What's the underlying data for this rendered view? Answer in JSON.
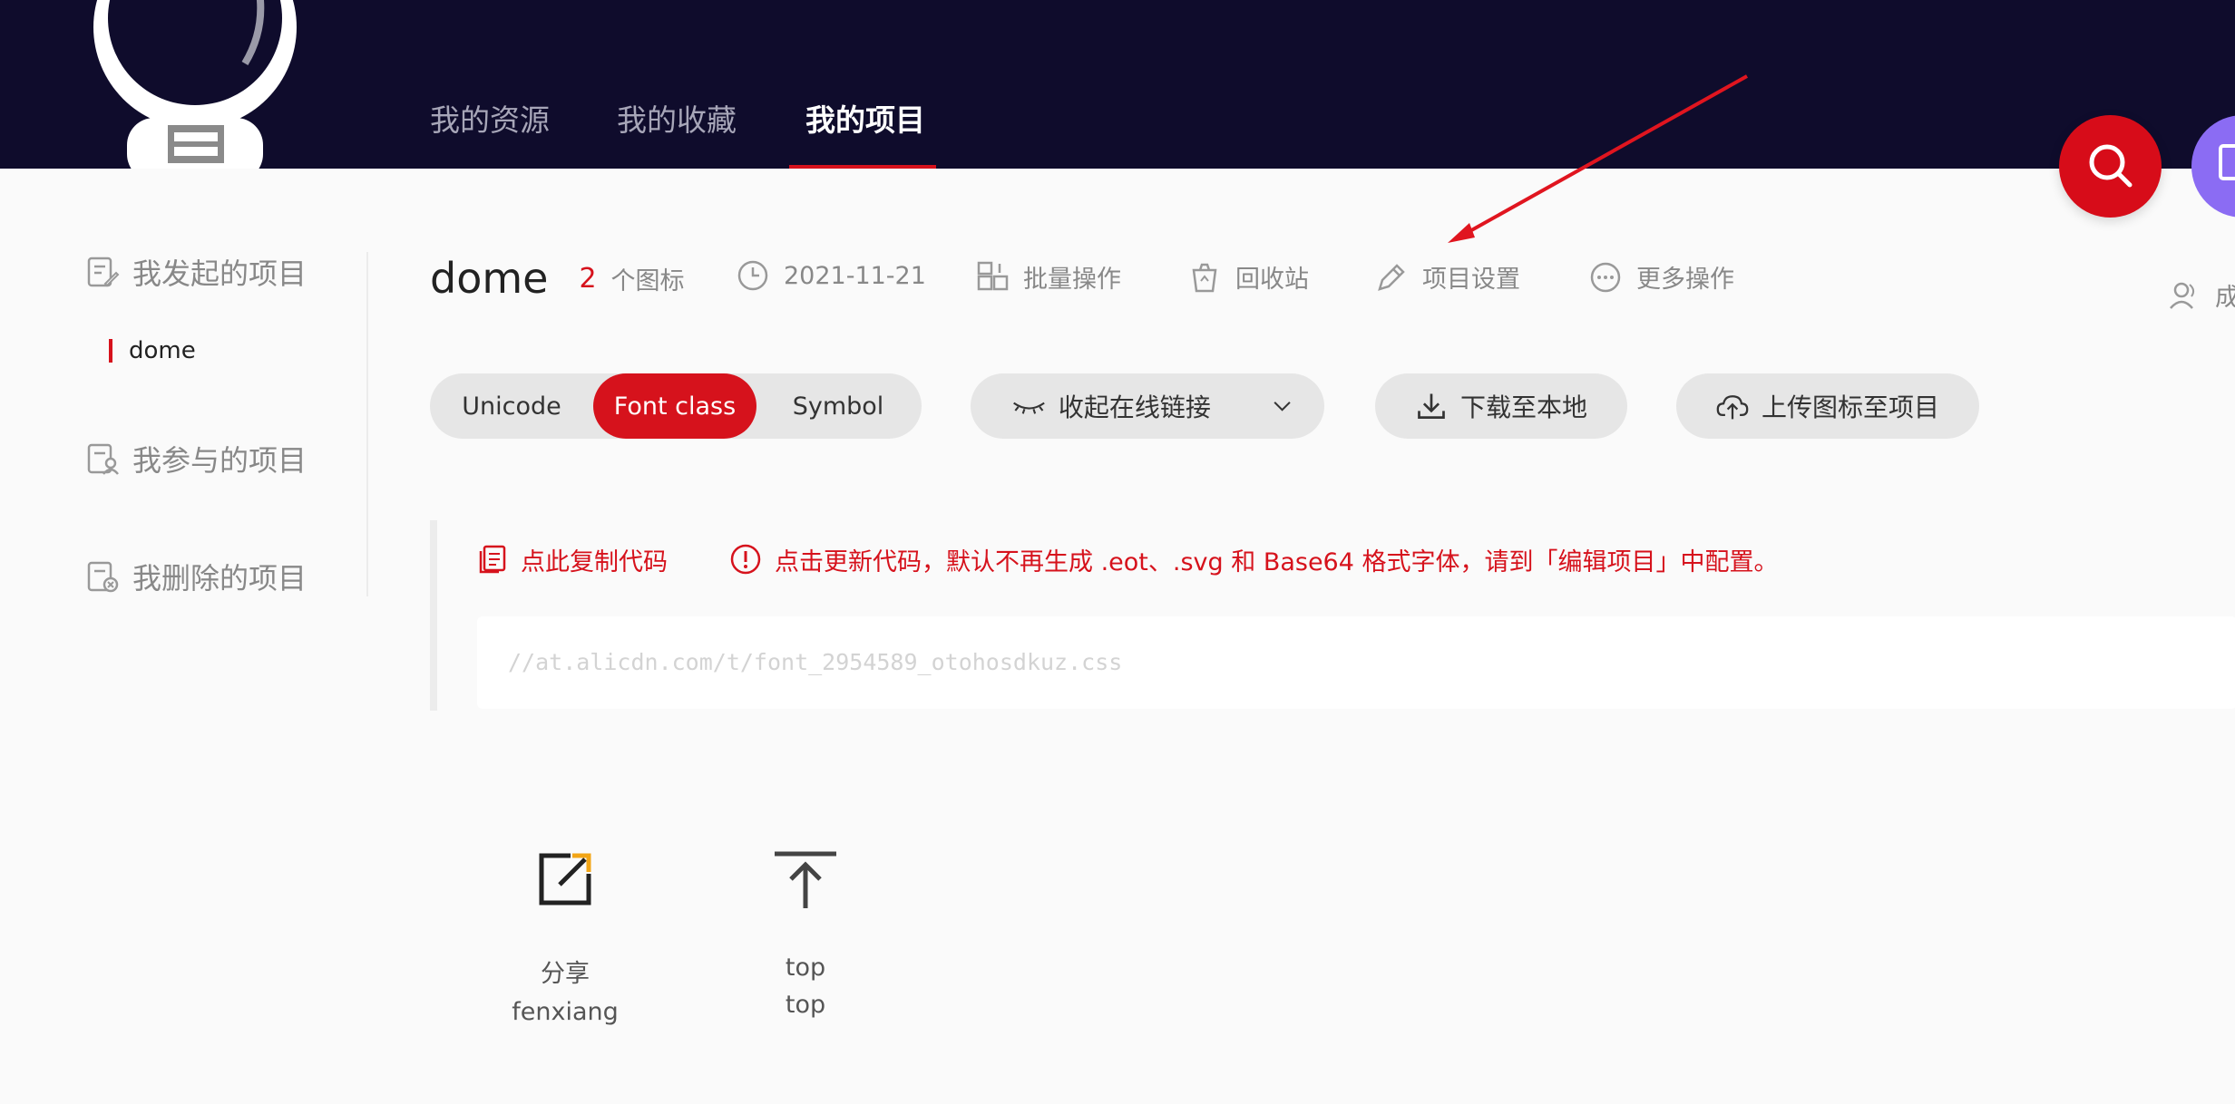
{
  "header": {
    "tabs": [
      {
        "label": "我的资源"
      },
      {
        "label": "我的收藏"
      },
      {
        "label": "我的项目"
      }
    ],
    "active_tab": "我的项目",
    "accent": "#d6121c",
    "background": "#0f0c2c"
  },
  "sidebar": {
    "groups": [
      {
        "label": "我发起的项目",
        "icon": "edit-doc-icon"
      },
      {
        "label": "我参与的项目",
        "icon": "user-doc-icon"
      },
      {
        "label": "我删除的项目",
        "icon": "delete-doc-icon"
      }
    ],
    "active_project": "dome"
  },
  "project": {
    "name": "dome",
    "icon_count": "2",
    "icon_count_label": "个图标",
    "date": "2021-11-21",
    "actions": [
      {
        "label": "批量操作",
        "icon": "batch-icon"
      },
      {
        "label": "回收站",
        "icon": "recycle-bin-icon"
      },
      {
        "label": "项目设置",
        "icon": "pencil-icon"
      },
      {
        "label": "更多操作",
        "icon": "more-icon"
      }
    ],
    "members_label": "成"
  },
  "toolbar": {
    "modes": [
      "Unicode",
      "Font class",
      "Symbol"
    ],
    "active_mode": "Font class",
    "collapse_link_label": "收起在线链接",
    "download_label": "下载至本地",
    "upload_label": "上传图标至项目"
  },
  "code": {
    "copy_label": "点此复制代码",
    "update_label": "点击更新代码，默认不再生成 .eot、.svg 和 Base64 格式字体，请到「编辑项目」中配置。",
    "url": "//at.alicdn.com/t/font_2954589_otohosdkuz.css"
  },
  "icons": [
    {
      "name": "分享",
      "code": "fenxiang",
      "icon": "share-icon"
    },
    {
      "name": "top",
      "code": "top",
      "icon": "arrow-top-icon"
    }
  ]
}
